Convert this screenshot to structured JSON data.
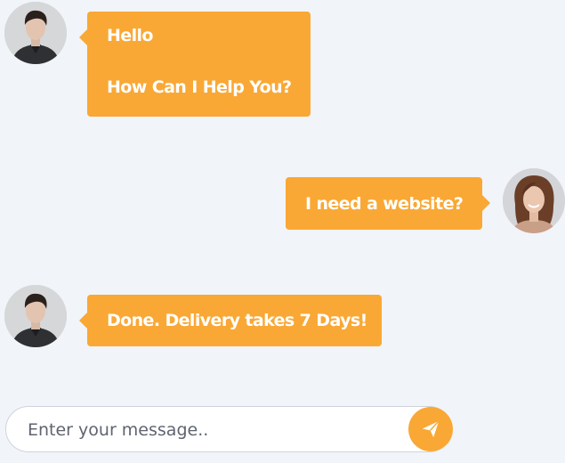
{
  "colors": {
    "accent": "#f9a835",
    "background": "#f1f4f9",
    "bubble_text": "#ffffff"
  },
  "messages": [
    {
      "side": "left",
      "avatar": "man-avatar",
      "lines": [
        "Hello",
        "How Can I Help You?"
      ]
    },
    {
      "side": "right",
      "avatar": "woman-avatar",
      "lines": [
        "I need a website?"
      ]
    },
    {
      "side": "left",
      "avatar": "man-avatar",
      "lines": [
        "Done. Delivery takes 7 Days!"
      ]
    }
  ],
  "composer": {
    "placeholder": "Enter your message..",
    "value": "",
    "send_icon": "paper-plane-icon"
  }
}
